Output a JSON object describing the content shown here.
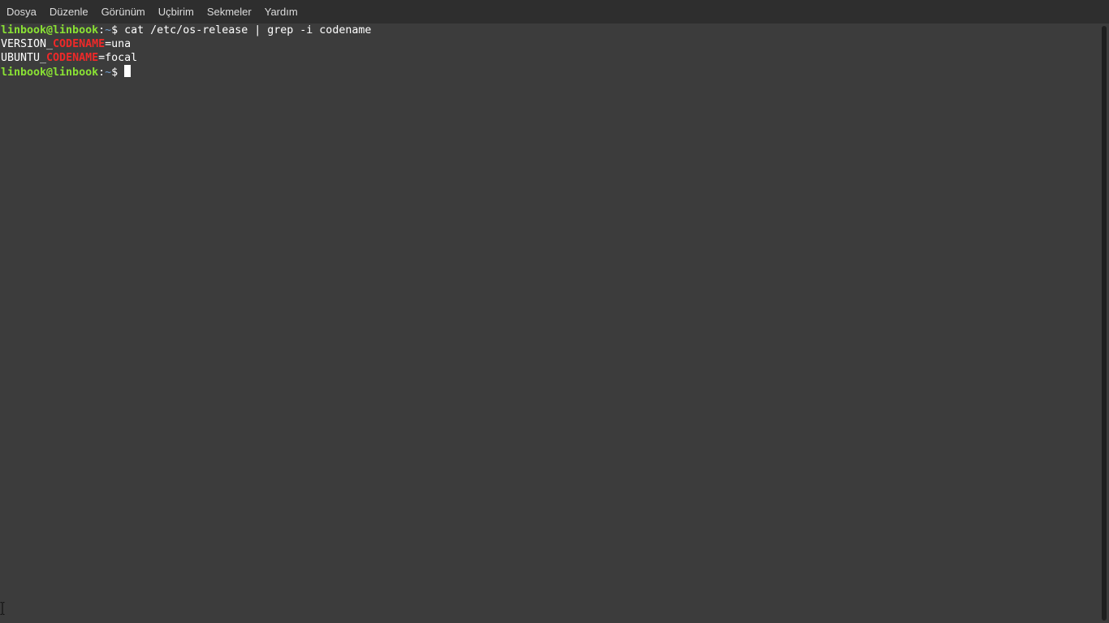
{
  "menubar": {
    "items": [
      "Dosya",
      "Düzenle",
      "Görünüm",
      "Uçbirim",
      "Sekmeler",
      "Yardım"
    ]
  },
  "terminal": {
    "line1": {
      "user": "linbook@linbook",
      "sep": ":",
      "path": "~",
      "sym": "$ ",
      "command": "cat /etc/os-release | grep -i codename"
    },
    "line2": {
      "pre": "VERSION_",
      "match": "CODENAME",
      "post": "=una"
    },
    "line3": {
      "pre": "UBUNTU_",
      "match": "CODENAME",
      "post": "=focal"
    },
    "line4": {
      "user": "linbook@linbook",
      "sep": ":",
      "path": "~",
      "sym": "$ "
    }
  },
  "colors": {
    "background": "#3c3c3c",
    "menubar": "#2e2e2e",
    "prompt_user": "#8ae234",
    "prompt_path": "#729fcf",
    "match": "#ef2929"
  },
  "icons": {
    "mouse_cursor": "i-beam-cursor-icon"
  }
}
